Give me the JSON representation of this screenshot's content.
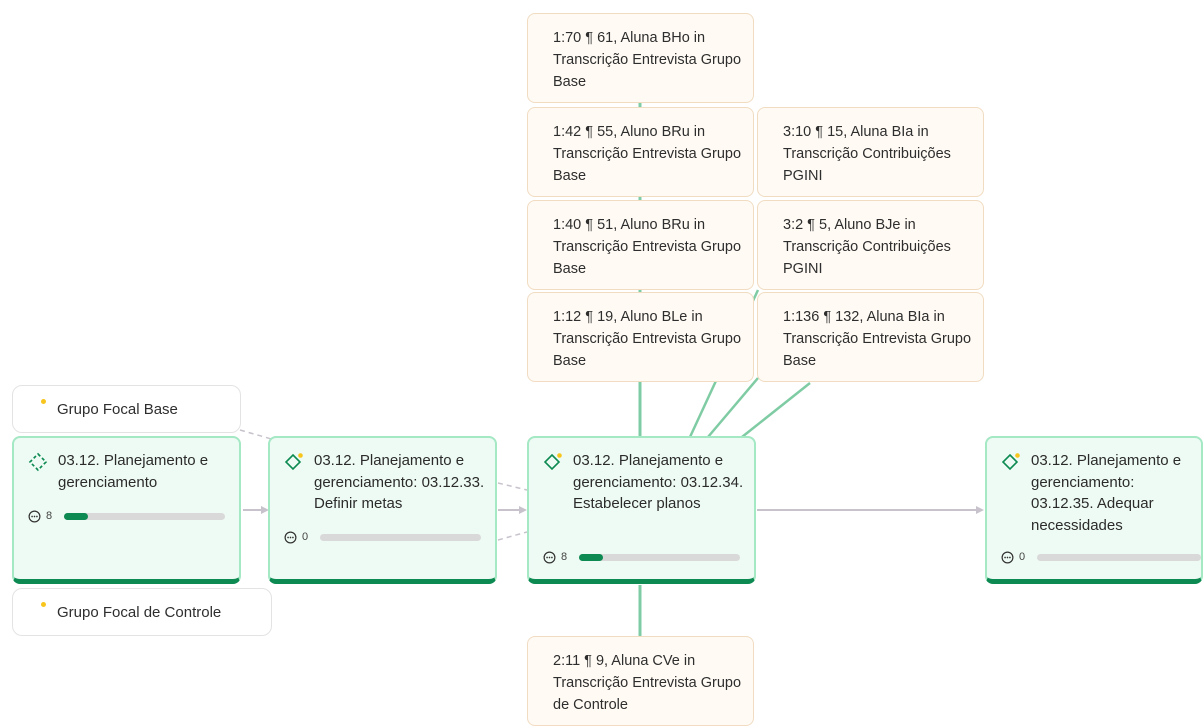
{
  "quotes": [
    {
      "id": "q1",
      "text": "1:70 ¶ 61, Aluna BHo in Transcrição Entrevista Grupo Base"
    },
    {
      "id": "q2",
      "text": "1:42 ¶ 55, Aluno BRu in Transcrição Entrevista Grupo Base"
    },
    {
      "id": "q3",
      "text": "3:10 ¶ 15, Aluna BIa in Transcrição Contribuições PGINI"
    },
    {
      "id": "q4",
      "text": "1:40 ¶ 51, Aluno BRu in Transcrição Entrevista Grupo Base"
    },
    {
      "id": "q5",
      "text": "3:2 ¶ 5, Aluno BJe in Transcrição Contribuições PGINI"
    },
    {
      "id": "q6",
      "text": "1:12 ¶ 19, Aluno BLe in Transcrição Entrevista Grupo Base"
    },
    {
      "id": "q7",
      "text": "1:136 ¶ 132, Aluna BIa in Transcrição Entrevista Grupo Base"
    },
    {
      "id": "q8",
      "text": "2:11 ¶ 9, Aluna CVe in Transcrição Entrevista Grupo de Controle"
    }
  ],
  "groups": [
    {
      "id": "g1",
      "label": "Grupo Focal Base"
    },
    {
      "id": "g2",
      "label": "Grupo Focal de Controle"
    }
  ],
  "codes": [
    {
      "id": "c1",
      "icon": "code-group-icon",
      "title": "03.12. Planejamento e gerenciamento",
      "comment_icon": "comment-icon",
      "count": "8",
      "progress": 0.15,
      "has_star": false
    },
    {
      "id": "c2",
      "icon": "code-diamond-icon",
      "title": "03.12. Planejamento e gerenciamento: 03.12.33. Definir metas",
      "comment_icon": "comment-icon",
      "count": "0",
      "progress": 0,
      "has_star": true
    },
    {
      "id": "c3",
      "icon": "code-diamond-icon",
      "title": "03.12. Planejamento e gerenciamento: 03.12.34. Estabelecer planos",
      "comment_icon": "comment-icon",
      "count": "8",
      "progress": 0.15,
      "has_star": true
    },
    {
      "id": "c4",
      "icon": "code-diamond-icon",
      "title": "03.12. Planejamento e gerenciamento: 03.12.35. Adequar necessidades",
      "comment_icon": "comment-icon",
      "count": "0",
      "progress": 0,
      "has_star": true
    }
  ],
  "colors": {
    "code_bg": "#eefbf4",
    "code_border": "#a4e8c4",
    "code_accent": "#0d8a52",
    "quote_bg": "#fffaf4",
    "quote_border": "#f1dcc2",
    "group_dot": "#f7c51b",
    "edge_gray": "#c7c2cc",
    "edge_green": "#7fcca4"
  }
}
